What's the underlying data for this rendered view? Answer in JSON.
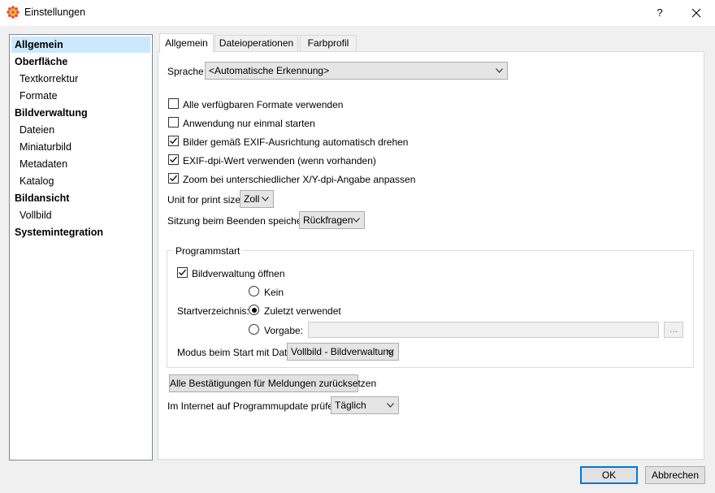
{
  "window": {
    "title": "Einstellungen",
    "help_glyph": "?",
    "app_icon": "xnview-icon",
    "close_icon": "close-icon"
  },
  "sidebar": {
    "items": [
      {
        "label": "Allgemein",
        "level": 0,
        "selected": true
      },
      {
        "label": "Oberfläche",
        "level": 0
      },
      {
        "label": "Textkorrektur",
        "level": 1
      },
      {
        "label": "Formate",
        "level": 1
      },
      {
        "label": "Bildverwaltung",
        "level": 0
      },
      {
        "label": "Dateien",
        "level": 1
      },
      {
        "label": "Miniaturbild",
        "level": 1
      },
      {
        "label": "Metadaten",
        "level": 1
      },
      {
        "label": "Katalog",
        "level": 1
      },
      {
        "label": "Bildansicht",
        "level": 0
      },
      {
        "label": "Vollbild",
        "level": 1
      },
      {
        "label": "Systemintegration",
        "level": 0
      }
    ]
  },
  "tabs": [
    {
      "label": "Allgemein",
      "active": true
    },
    {
      "label": "Dateioperationen"
    },
    {
      "label": "Farbprofil"
    }
  ],
  "general": {
    "language_label": "Sprache",
    "language_value": "<Automatische Erkennung>",
    "checkboxes": [
      {
        "label": "Alle verfügbaren Formate verwenden",
        "checked": false
      },
      {
        "label": "Anwendung nur einmal starten",
        "checked": false
      },
      {
        "label": "Bilder gemäß EXIF-Ausrichtung automatisch drehen",
        "checked": true
      },
      {
        "label": "EXIF-dpi-Wert verwenden (wenn vorhanden)",
        "checked": true
      },
      {
        "label": "Zoom bei unterschiedlicher X/Y-dpi-Angabe anpassen",
        "checked": true
      }
    ],
    "print_unit_label": "Unit for print size",
    "print_unit_value": "Zoll",
    "session_label": "Sitzung beim Beenden speichern",
    "session_value": "Rückfragen"
  },
  "startup": {
    "group_title": "Programmstart",
    "open_browser_label": "Bildverwaltung öffnen",
    "open_browser_checked": true,
    "start_dir_label": "Startverzeichnis:",
    "radios": [
      {
        "label": "Kein",
        "selected": false
      },
      {
        "label": "Zuletzt verwendet",
        "selected": true
      },
      {
        "label": "Vorgabe:",
        "selected": false
      }
    ],
    "path_value": "",
    "browse_label": "...",
    "mode_label": "Modus beim Start mit Datei",
    "mode_value": "Vollbild - Bildverwaltung"
  },
  "reset_button_label": "Alle Bestätigungen für Meldungen zurücksetzen",
  "update_label": "Im Internet auf Programmupdate prüfen",
  "update_value": "Täglich",
  "footer": {
    "ok_label": "OK",
    "cancel_label": "Abbrechen"
  },
  "colors": {
    "selection": "#cce8ff",
    "accent": "#0078d7"
  }
}
